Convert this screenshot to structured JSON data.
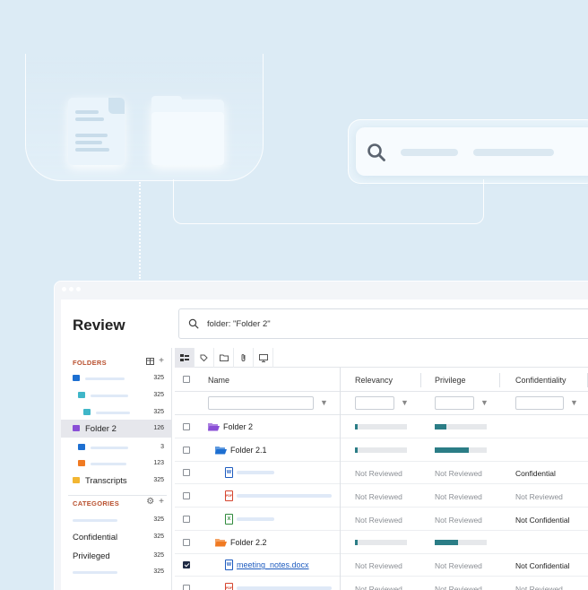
{
  "app": {
    "title": "Review",
    "search_query": "folder: \"Folder 2\""
  },
  "sidebar": {
    "folders_heading": "FOLDERS",
    "folders": [
      {
        "label": "",
        "count": "325",
        "level": 0,
        "color": "#1d6fd1"
      },
      {
        "label": "",
        "count": "325",
        "level": 1,
        "color": "#3fb6c8"
      },
      {
        "label": "",
        "count": "325",
        "level": 2,
        "color": "#3fb6c8"
      },
      {
        "label": "Folder 2",
        "count": "126",
        "level": 0,
        "color": "#8a4fd6",
        "selected": true
      },
      {
        "label": "",
        "count": "3",
        "level": 1,
        "color": "#1d6fd1"
      },
      {
        "label": "",
        "count": "123",
        "level": 1,
        "color": "#f07a22"
      },
      {
        "label": "Transcripts",
        "count": "325",
        "level": 0,
        "color": "#f2b632"
      }
    ],
    "categories_heading": "CATEGORIES",
    "categories": [
      {
        "label": "",
        "count": "325"
      },
      {
        "label": "Confidential",
        "count": "325"
      },
      {
        "label": "Privileged",
        "count": "325"
      },
      {
        "label": "",
        "count": "325"
      }
    ]
  },
  "grid": {
    "columns": {
      "name": "Name",
      "relevancy": "Relevancy",
      "privilege": "Privilege",
      "confidentiality": "Confidentiality"
    },
    "rows": [
      {
        "type": "folder",
        "name": "Folder 2",
        "indent": 0,
        "color": "#8a4fd6",
        "relevancy": 0.05,
        "privilege": 0.22,
        "confidentiality": "",
        "checked": false
      },
      {
        "type": "folder",
        "name": "Folder 2.1",
        "indent": 1,
        "color": "#1d6fd1",
        "relevancy": 0.05,
        "privilege": 0.65,
        "confidentiality": "",
        "checked": false
      },
      {
        "type": "word",
        "name": "",
        "indent": 2,
        "relevancy_text": "Not Reviewed",
        "privilege_text": "Not Reviewed",
        "confidentiality": "Confidential",
        "checked": false
      },
      {
        "type": "pdf",
        "name": "",
        "indent": 2,
        "relevancy_text": "Not Reviewed",
        "privilege_text": "Not Reviewed",
        "confidentiality": "Not Reviewed",
        "checked": false
      },
      {
        "type": "excel",
        "name": "",
        "indent": 2,
        "relevancy_text": "Not Reviewed",
        "privilege_text": "Not Reviewed",
        "confidentiality": "Not Confidential",
        "checked": false
      },
      {
        "type": "folder",
        "name": "Folder 2.2",
        "indent": 1,
        "color": "#f07a22",
        "relevancy": 0.05,
        "privilege": 0.45,
        "confidentiality": "",
        "checked": false
      },
      {
        "type": "word",
        "name": "meeting_notes.docx",
        "indent": 2,
        "relevancy_text": "Not Reviewed",
        "privilege_text": "Not Reviewed",
        "confidentiality": "Not Confidential",
        "checked": true
      },
      {
        "type": "pdf",
        "name": "",
        "indent": 2,
        "relevancy_text": "Not Reviewed",
        "privilege_text": "Not Reviewed",
        "confidentiality": "Not Reviewed",
        "checked": false
      }
    ]
  },
  "icons": {
    "word": "W",
    "pdf": "PDF",
    "excel": "X"
  },
  "colors": {
    "accent_teal": "#2b7d86",
    "category_heading": "#b9502e",
    "link": "#1d5bbf"
  }
}
